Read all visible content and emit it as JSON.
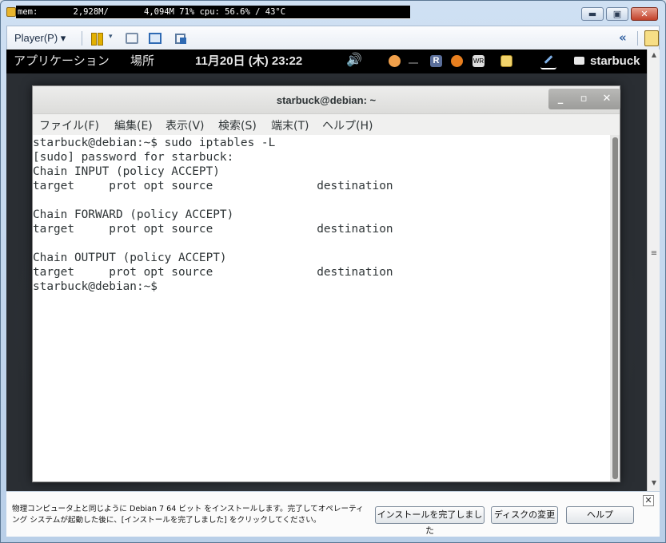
{
  "window": {
    "status_line": "mem:       2,928M/       4,094M 71% cpu: 56.6% / 43°C",
    "min_label": "▬",
    "max_label": "▣",
    "close_label": "✕"
  },
  "toolbar": {
    "player_label": "Player(P) ▾",
    "pause_caret": "▾",
    "back_label": "«"
  },
  "gnome_panel": {
    "applications": "アプリケーション",
    "places": "場所",
    "clock": "11月20日 (木) 23:22",
    "volume_icon": "🔊",
    "tray_r": "R",
    "tray_net": "WR",
    "user": "starbuck"
  },
  "terminal": {
    "title": "starbuck@debian: ~",
    "buttons": {
      "min": "_",
      "max": "▫",
      "close": "✕"
    },
    "menu": {
      "file": "ファイル(F)",
      "edit": "編集(E)",
      "view": "表示(V)",
      "search": "検索(S)",
      "terminal": "端末(T)",
      "help": "ヘルプ(H)"
    },
    "content": "starbuck@debian:~$ sudo iptables -L\n[sudo] password for starbuck:\nChain INPUT (policy ACCEPT)\ntarget     prot opt source               destination\n\nChain FORWARD (policy ACCEPT)\ntarget     prot opt source               destination\n\nChain OUTPUT (policy ACCEPT)\ntarget     prot opt source               destination\nstarbuck@debian:~$"
  },
  "scrollbar": {
    "up": "▲",
    "grip": "≡",
    "down": "▼"
  },
  "notification": {
    "text": "物理コンピュータ上と同じように Debian 7 64 ビット をインストールします。完了してオペレーティング システムが起動した後に、[インストールを完了しました] をクリックしてください。",
    "finish_button": "インストールを完了しました",
    "disk_button": "ディスクの変更",
    "help_button": "ヘルプ",
    "close_label": "✕"
  }
}
